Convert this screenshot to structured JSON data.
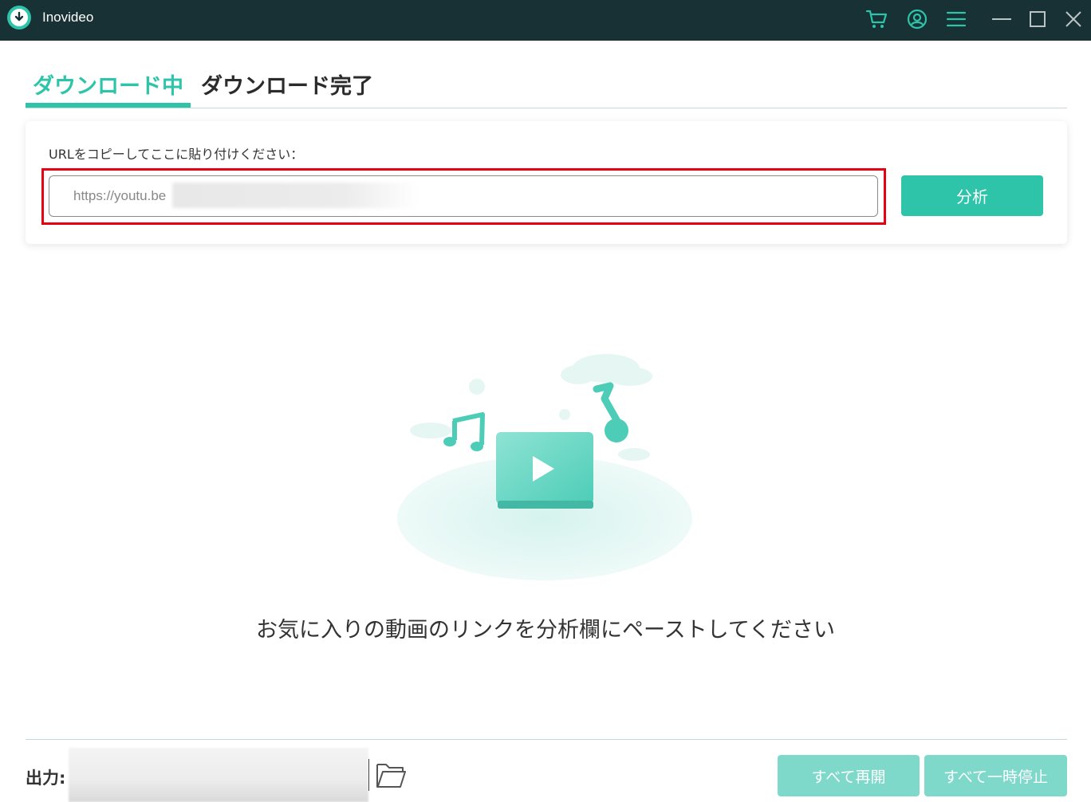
{
  "window": {
    "title": "Inovideo",
    "icons": [
      "logo-icon",
      "cart-icon",
      "account-icon",
      "menu-icon",
      "minimize-icon",
      "maximize-icon",
      "close-icon"
    ]
  },
  "tabs": [
    {
      "label": "ダウンロード中",
      "active": true
    },
    {
      "label": "ダウンロード完了",
      "active": false
    }
  ],
  "url_panel": {
    "label": "URLをコピーしてここに貼り付けください：",
    "input_value": "https://youtu.be",
    "analyze_label": "分析"
  },
  "empty_state": {
    "message": "お気に入りの動画のリンクを分析欄にペーストしてください",
    "illustration": "video-music-cloud-illustration"
  },
  "footer": {
    "output_label": "出力:",
    "resume_all_label": "すべて再開",
    "pause_all_label": "すべて一時停止"
  },
  "colors": {
    "titlebar": "#173135",
    "accent": "#2ec4a9",
    "accent_disabled": "#7ed9cb",
    "highlight": "#e60012"
  }
}
